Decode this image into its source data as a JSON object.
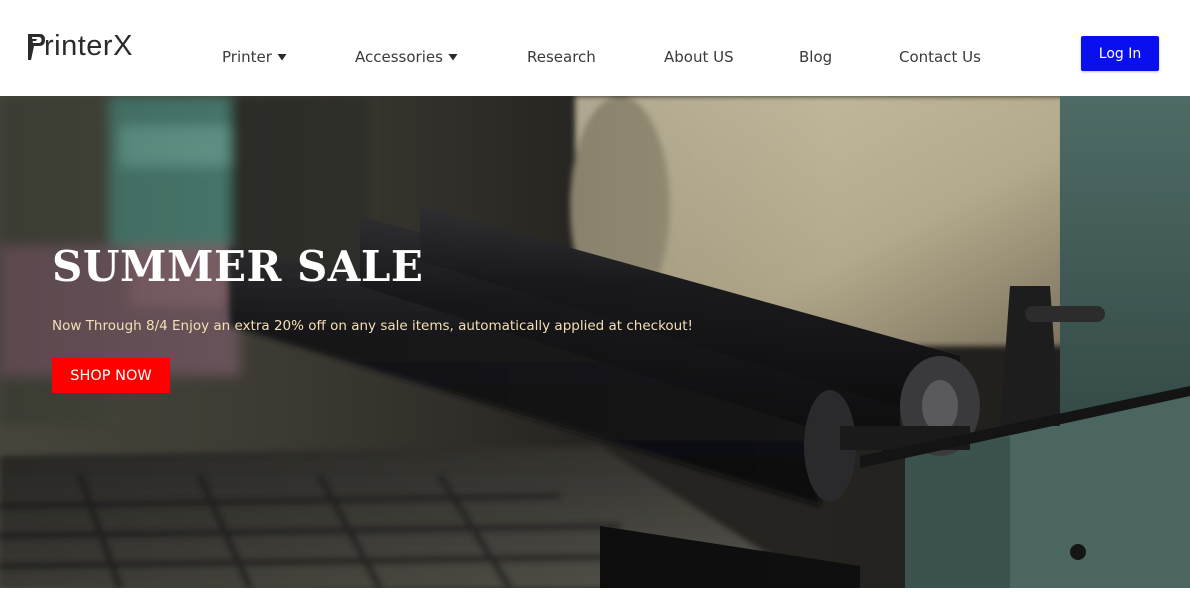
{
  "brand": {
    "logo_text": "rinterX"
  },
  "nav": {
    "items": [
      {
        "label": "Printer",
        "has_dropdown": true
      },
      {
        "label": "Accessories",
        "has_dropdown": true
      },
      {
        "label": "Research",
        "has_dropdown": false
      },
      {
        "label": "About US",
        "has_dropdown": false
      },
      {
        "label": "Blog",
        "has_dropdown": false
      },
      {
        "label": "Contact Us",
        "has_dropdown": false
      }
    ],
    "login_label": "Log In"
  },
  "hero": {
    "title": "SUMMER SALE",
    "subtitle": "Now Through 8/4 Enjoy an extra 20% off on any sale items, automatically applied at checkout!",
    "cta_label": "SHOP NOW"
  },
  "colors": {
    "login_button": "#0a0ff0",
    "cta_button": "#ff0000",
    "subtitle_text": "#f5dfb8",
    "nav_text": "#3a3a3a"
  },
  "icons": {
    "logo": "printer-p-logo-icon",
    "dropdown": "caret-down-icon"
  }
}
